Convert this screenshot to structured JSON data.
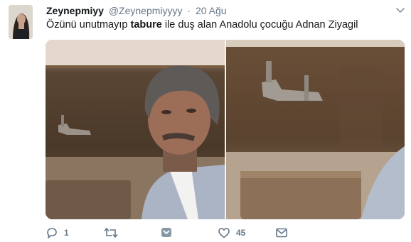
{
  "tweet": {
    "display_name": "Zeynepmiyy",
    "handle": "@Zeynepmiyyyy",
    "separator": "·",
    "date": "20 Ağu",
    "text_before": "Özünü unutmayıp ",
    "text_bold": "tabure",
    "text_after": " ile duş alan Anadolu çocuğu Adnan Ziyagil"
  },
  "actions": {
    "reply_count": "1",
    "retweet_count": "",
    "like_count": "45"
  },
  "colors": {
    "icon_gray": "#657786",
    "text_dark": "#14171a",
    "save_icon": "#8899a6"
  }
}
